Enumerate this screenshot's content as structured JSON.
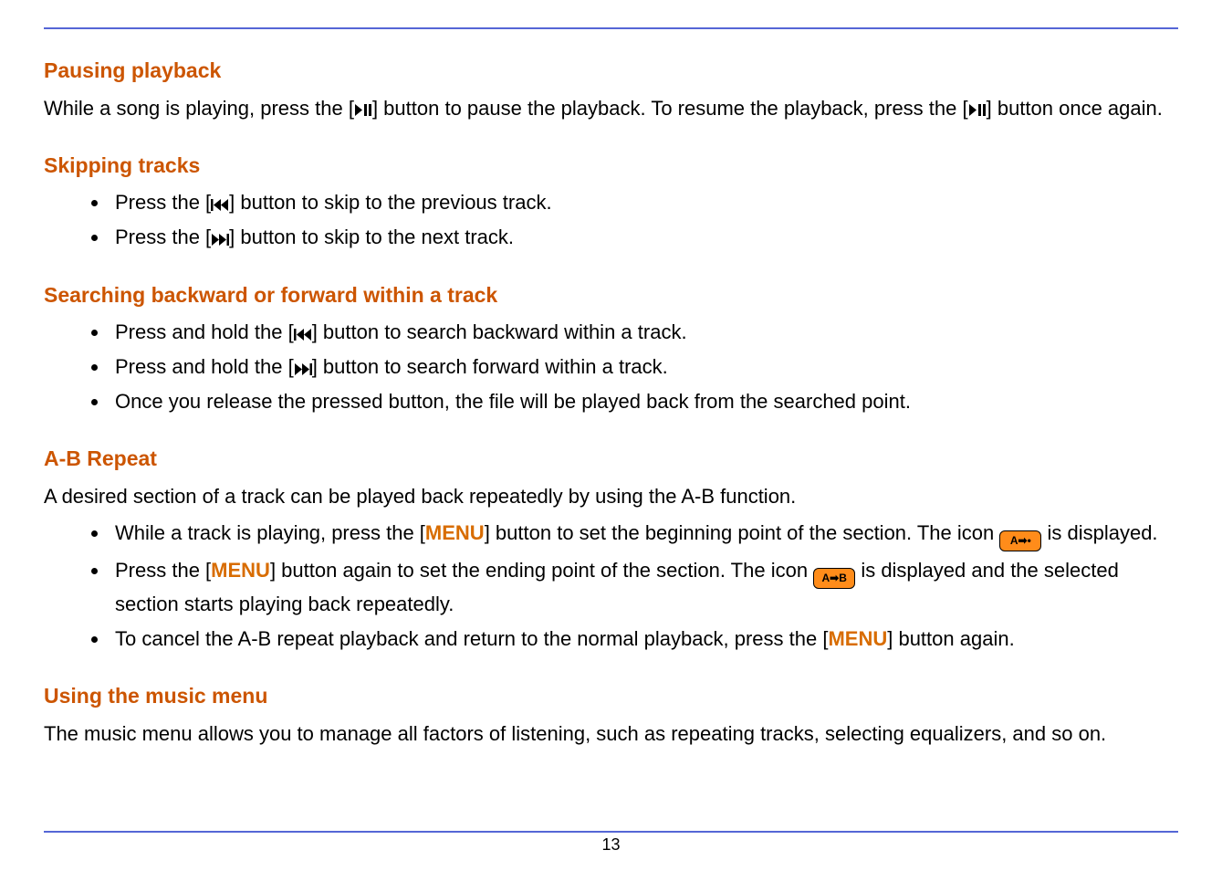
{
  "sections": {
    "pause": {
      "heading": "Pausing playback",
      "para_parts": {
        "t1": "While a song is playing, press the [",
        "t2": "] button to pause the playback. To resume the playback, press the [",
        "t3": "] button once again."
      }
    },
    "skip": {
      "heading": "Skipping tracks",
      "items": {
        "b1a": "Press the [",
        "b1b": "] button to skip to the previous track.",
        "b2a": "Press the [",
        "b2b": "] button to skip to the next track."
      }
    },
    "search": {
      "heading": "Searching backward or forward within a track",
      "items": {
        "b1a": "Press and hold the [",
        "b1b": "] button to search backward within a track.",
        "b2a": "Press and hold the [",
        "b2b": "] button to search forward within a track.",
        "b3": "Once you release the pressed button, the file will be played back from the searched point."
      }
    },
    "ab": {
      "heading": "A-B Repeat",
      "intro": "A desired section of a track can be played back repeatedly by using the A-B function.",
      "items": {
        "b1a": "While a track is playing, press the [",
        "b1_key": "MENU",
        "b1b": "] button to set the beginning point of the section. The icon ",
        "b1c": " is displayed.",
        "b2a": "Press the [",
        "b2_key": "MENU",
        "b2b": "] button again to set the ending point of the section. The icon ",
        "b2c": " is displayed and the selected section starts playing back repeatedly.",
        "b3a": "To cancel the A-B repeat playback and return to the normal playback, press the [",
        "b3_key": "MENU",
        "b3b": "] button again."
      },
      "badge1_text": "A➡•",
      "badge2_text": "A➡B"
    },
    "menu": {
      "heading": "Using the music menu",
      "para": "The music menu allows you to manage all factors of listening, such as repeating tracks, selecting equalizers, and so on."
    }
  },
  "icons": {
    "play_pause": "play-pause-icon",
    "prev": "skip-prev-icon",
    "next": "skip-next-icon"
  },
  "page_number": "13"
}
